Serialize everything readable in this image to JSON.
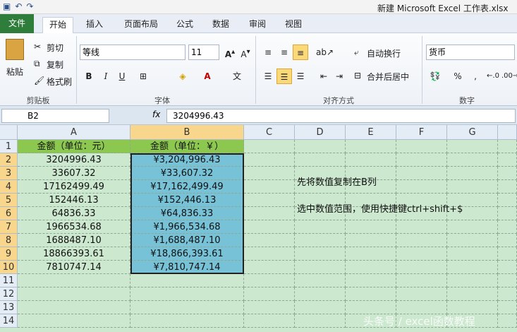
{
  "window": {
    "title": "新建 Microsoft Excel 工作表.xlsx"
  },
  "ribbon_tabs": [
    "文件",
    "开始",
    "插入",
    "页面布局",
    "公式",
    "数据",
    "审阅",
    "视图"
  ],
  "ribbon": {
    "clipboard": {
      "paste": "粘贴",
      "cut": "剪切",
      "copy": "复制",
      "format_painter": "格式刷",
      "label": "剪贴板"
    },
    "font": {
      "name": "等线",
      "size": "11",
      "label": "字体"
    },
    "alignment": {
      "wrap": "自动换行",
      "merge": "合并后居中",
      "label": "对齐方式"
    },
    "number": {
      "format": "货币",
      "label": "数字",
      "percent": "%",
      "comma": ","
    }
  },
  "formula_bar": {
    "name_box": "B2",
    "fx": "fx",
    "value": "3204996.43"
  },
  "columns": [
    "A",
    "B",
    "C",
    "D",
    "E",
    "F",
    "G"
  ],
  "rows": [
    "1",
    "2",
    "3",
    "4",
    "5",
    "6",
    "7",
    "8",
    "9",
    "10",
    "11",
    "12",
    "13",
    "14"
  ],
  "table": {
    "header_a": "金额（单位：元）",
    "header_b": "金额（单位：￥）",
    "col_a": [
      "3204996.43",
      "33607.32",
      "17162499.49",
      "152446.13",
      "64836.33",
      "1966534.68",
      "1688487.10",
      "18866393.61",
      "7810747.14"
    ],
    "col_b": [
      "¥3,204,996.43",
      "¥33,607.32",
      "¥17,162,499.49",
      "¥152,446.13",
      "¥64,836.33",
      "¥1,966,534.68",
      "¥1,688,487.10",
      "¥18,866,393.61",
      "¥7,810,747.14"
    ]
  },
  "notes": {
    "d3": "先将数值复制在B列",
    "d5": "选中数值范围，使用快捷键ctrl+shift+$"
  },
  "watermark": "头条号 / excel函数教程"
}
